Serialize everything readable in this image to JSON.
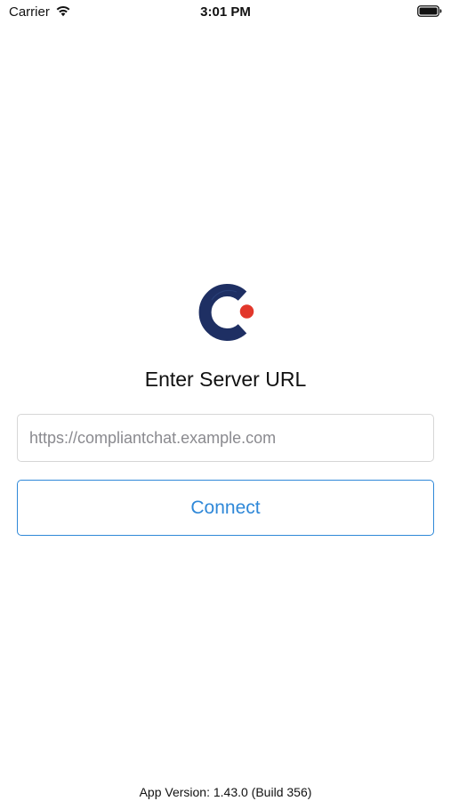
{
  "status_bar": {
    "carrier": "Carrier",
    "time": "3:01 PM",
    "wifi_icon": "wifi-icon",
    "battery_icon": "battery-icon"
  },
  "logo": {
    "icon": "compliantchat-logo",
    "colors": {
      "ring": "#1e2f63",
      "dot": "#e2372b"
    }
  },
  "title": "Enter Server URL",
  "server_url_input": {
    "value": "",
    "placeholder": "https://compliantchat.example.com"
  },
  "connect_button": {
    "label": "Connect",
    "color": "#2f88d8"
  },
  "footer": {
    "app_version": "App Version: 1.43.0 (Build 356)"
  }
}
